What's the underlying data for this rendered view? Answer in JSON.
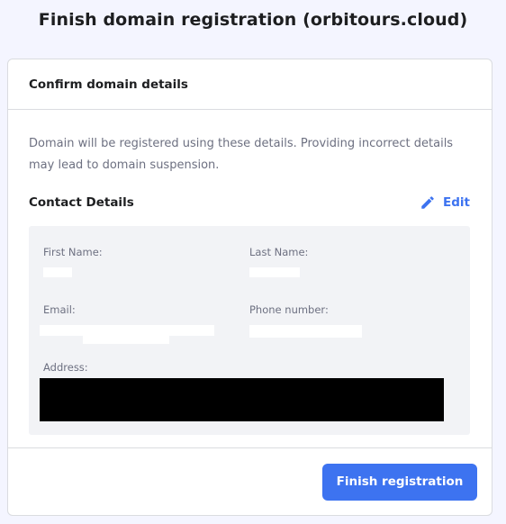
{
  "page": {
    "title": "Finish domain registration (orbitours.cloud)"
  },
  "card": {
    "header_title": "Confirm domain details",
    "description": "Domain will be registered using these details. Providing incorrect details may lead to domain suspension.",
    "contact_title": "Contact Details",
    "edit_label": "Edit",
    "fields": {
      "first_name_label": "First Name:",
      "last_name_label": "Last Name:",
      "email_label": "Email:",
      "phone_label": "Phone number:",
      "address_label": "Address:"
    },
    "finish_label": "Finish registration"
  },
  "colors": {
    "accent": "#3d73f0",
    "background": "#f4f5ff",
    "details_bg": "#f2f3f6"
  },
  "icons": {
    "edit": "pencil-icon"
  }
}
